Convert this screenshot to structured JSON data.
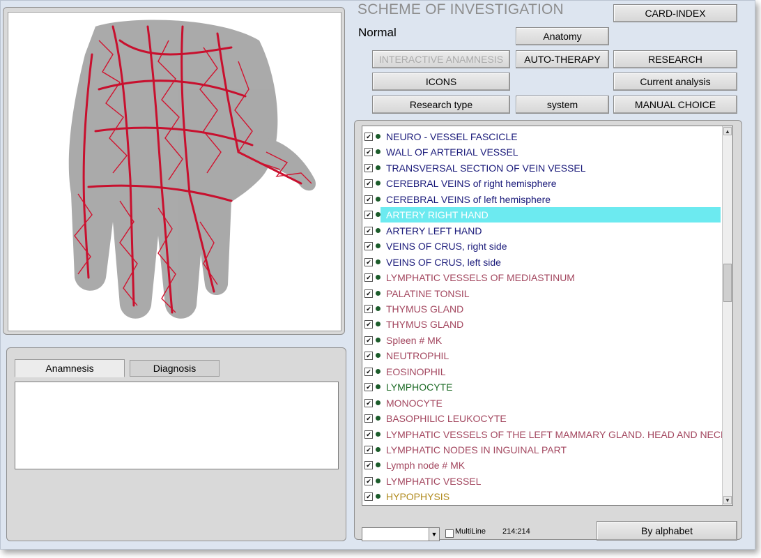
{
  "header": {
    "title": "SCHEME OF INVESTIGATION",
    "mode": "Normal"
  },
  "buttons": {
    "card_index": "CARD-INDEX",
    "anatomy": "Anatomy",
    "interactive_anamnesis": "INTERACTIVE ANAMNESIS",
    "auto_therapy": "AUTO-THERAPY",
    "research": "RESEARCH",
    "icons": "ICONS",
    "current_analysis": "Current analysis",
    "research_type": "Research type",
    "system": "system",
    "manual_choice": "MANUAL CHOICE",
    "by_alphabet": "By alphabet"
  },
  "tabs": [
    {
      "label": "Anamnesis",
      "active": true
    },
    {
      "label": "Diagnosis",
      "active": false
    }
  ],
  "list": {
    "items": [
      {
        "label": "NEURO - VESSEL  FASCICLE",
        "color": "#1a1a7a"
      },
      {
        "label": "WALL OF ARTERIAL VESSEL",
        "color": "#1a1a7a"
      },
      {
        "label": "TRANSVERSAL SECTION OF VEIN VESSEL",
        "color": "#1a1a7a"
      },
      {
        "label": "CEREBRAL VEINS of right hemisphere",
        "color": "#1a1a7a"
      },
      {
        "label": "CEREBRAL VEINS of left hemisphere",
        "color": "#1a1a7a"
      },
      {
        "label": "ARTERY RIGHT HAND",
        "color": "#ffffff",
        "selected": true
      },
      {
        "label": "ARTERY LEFT HAND",
        "color": "#1a1a7a"
      },
      {
        "label": "VEINS OF CRUS, right side",
        "color": "#1a1a7a"
      },
      {
        "label": "VEINS OF CRUS, left side",
        "color": "#1a1a7a"
      },
      {
        "label": "LYMPHATIC VESSELS OF MEDIASTINUM",
        "color": "#a3475f"
      },
      {
        "label": "PALATINE TONSIL",
        "color": "#a3475f"
      },
      {
        "label": "THYMUS GLAND",
        "color": "#a3475f"
      },
      {
        "label": "THYMUS GLAND",
        "color": "#a3475f"
      },
      {
        "label": "Spleen # MK",
        "color": "#a3475f"
      },
      {
        "label": "NEUTROPHIL",
        "color": "#a3475f"
      },
      {
        "label": "EOSINOPHIL",
        "color": "#a3475f"
      },
      {
        "label": "LYMPHOCYTE",
        "color": "#1d6b26"
      },
      {
        "label": "MONOCYTE",
        "color": "#a3475f"
      },
      {
        "label": "BASOPHILIC LEUKOCYTE",
        "color": "#a3475f"
      },
      {
        "label": "LYMPHATIC VESSELS OF THE LEFT MAMMARY GLAND. HEAD AND NECK",
        "color": "#a3475f"
      },
      {
        "label": "LYMPHATIC NODES IN INGUINAL PART",
        "color": "#a3475f"
      },
      {
        "label": "Lymph node # MK",
        "color": "#a3475f"
      },
      {
        "label": "LYMPHATIC VESSEL",
        "color": "#a3475f"
      },
      {
        "label": "HYPOPHYSIS",
        "color": "#b08a1c"
      }
    ],
    "selected_bg": "#6ceaf0"
  },
  "footer": {
    "multiline_label": "MultiLine",
    "counter": "214:214",
    "combo_value": ""
  },
  "icons": {
    "check": "checkmark-icon",
    "scroll_up": "triangle-up-icon",
    "scroll_down": "triangle-down-icon",
    "combo_dropdown": "triangle-down-icon"
  }
}
